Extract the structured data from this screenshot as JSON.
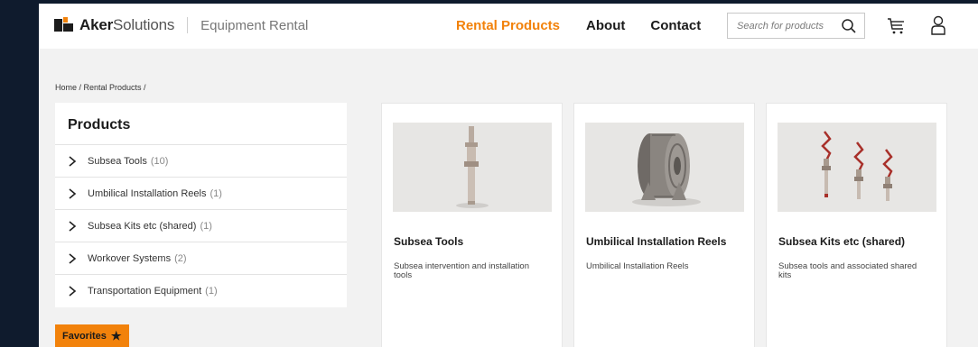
{
  "header": {
    "logo_bold": "Aker",
    "logo_light": "Solutions",
    "logo_sub": "Equipment Rental",
    "nav": [
      "Rental Products",
      "About",
      "Contact"
    ],
    "search_placeholder": "Search for products",
    "accent_color": "#f2820b"
  },
  "breadcrumb": "Home / Rental Products /",
  "sidebar": {
    "title": "Products",
    "items": [
      {
        "label": "Subsea Tools",
        "count": "(10)"
      },
      {
        "label": "Umbilical Installation Reels",
        "count": "(1)"
      },
      {
        "label": "Subsea Kits etc (shared)",
        "count": "(1)"
      },
      {
        "label": "Workover Systems",
        "count": "(2)"
      },
      {
        "label": "Transportation Equipment",
        "count": "(1)"
      }
    ]
  },
  "favorites": {
    "label": "Favorites",
    "icon": "star-icon"
  },
  "cards": [
    {
      "title": "Subsea Tools",
      "desc": "Subsea intervention and installation tools"
    },
    {
      "title": "Umbilical Installation Reels",
      "desc": "Umbilical Installation Reels"
    },
    {
      "title": "Subsea Kits etc (shared)",
      "desc": "Subsea tools and associated shared kits"
    }
  ]
}
